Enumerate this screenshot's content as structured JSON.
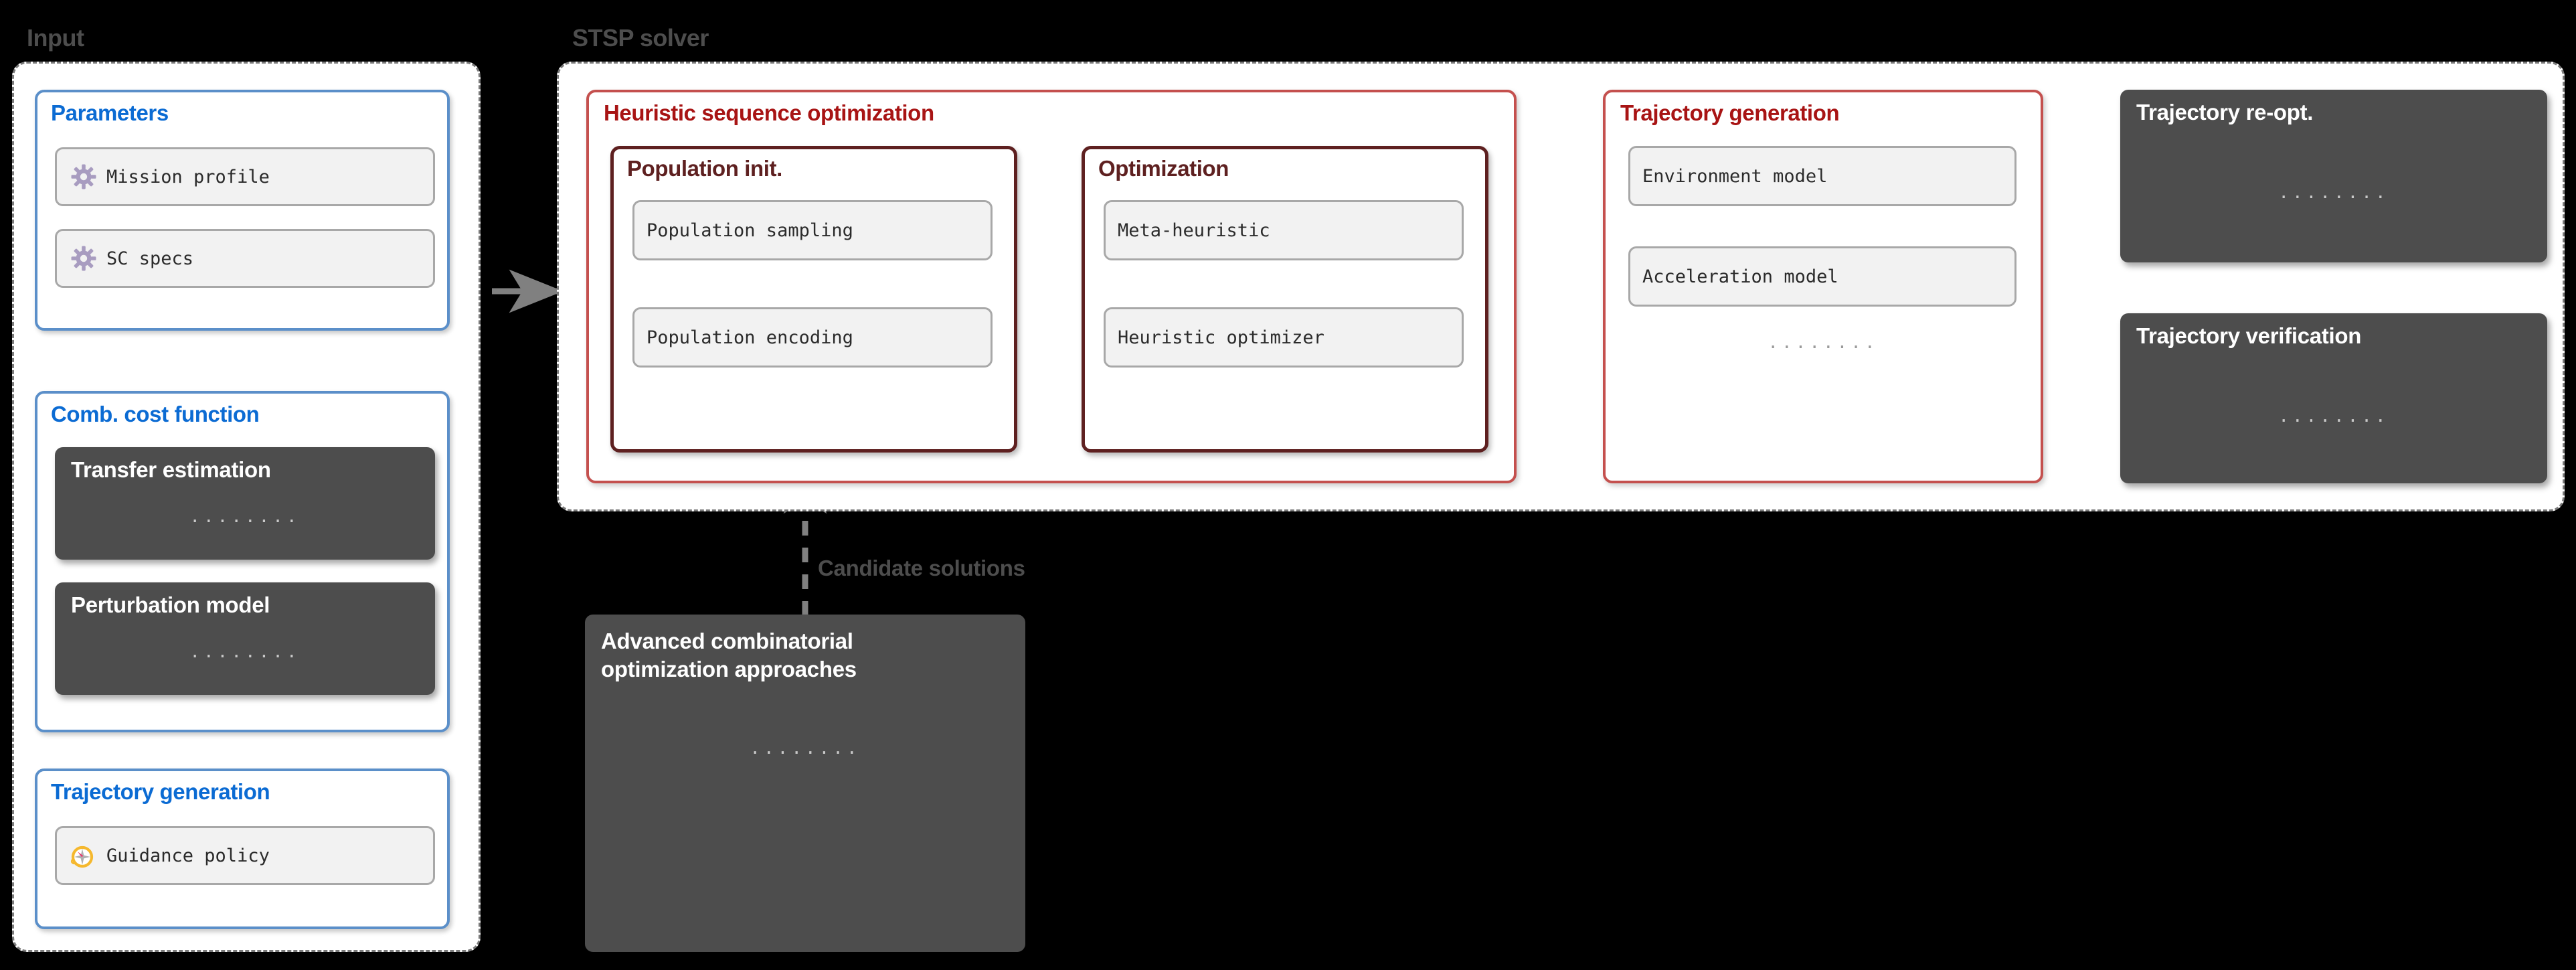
{
  "groups": {
    "input": {
      "label": "Input"
    },
    "stsp": {
      "label": "STSP solver"
    }
  },
  "input_panels": [
    {
      "title": "Parameters",
      "items": [
        {
          "label": "Mission profile",
          "icon": "gear-icon"
        },
        {
          "label": "SC specs",
          "icon": "gear-icon"
        }
      ]
    },
    {
      "title": "Comb. cost function",
      "dark_items": [
        {
          "label": "Transfer  estimation",
          "dots": "········"
        },
        {
          "label": "Perturbation model",
          "dots": "········"
        }
      ]
    },
    {
      "title": "Trajectory generation",
      "items": [
        {
          "label": "Guidance policy",
          "icon": "compass-icon"
        }
      ]
    }
  ],
  "stsp": {
    "heuristic": {
      "title": "Heuristic sequence optimization",
      "sub_panels": [
        {
          "title": "Population init.",
          "items": [
            {
              "label": "Population sampling"
            },
            {
              "label": "Population encoding"
            }
          ]
        },
        {
          "title": "Optimization",
          "items": [
            {
              "label": "Meta-heuristic"
            },
            {
              "label": "Heuristic optimizer"
            }
          ]
        }
      ]
    },
    "trajectory_generation": {
      "title": "Trajectory generation",
      "items": [
        {
          "label": "Environment model"
        },
        {
          "label": "Acceleration model"
        }
      ],
      "dots": "········"
    },
    "outputs": [
      {
        "title": "Trajectory re-opt.",
        "dots": "········"
      },
      {
        "title": "Trajectory verification",
        "dots": "········"
      }
    ]
  },
  "advanced": {
    "title_line1": "Advanced combinatorial",
    "title_line2": "optimization approaches",
    "dots": "········"
  },
  "edges": {
    "candidate_solutions": "Candidate solutions"
  },
  "colors": {
    "blue_accent": "#0b6bd3",
    "blue_border": "#5b8fc9",
    "red_accent": "#a81414",
    "red_border": "#c4504e",
    "darkred": "#5e2020",
    "dark_fill": "#4d4d4d",
    "group_label": "#4d4d4d",
    "arrow": "#808080",
    "gear": "#a89cc0",
    "compass_ring": "#f5b82e"
  }
}
